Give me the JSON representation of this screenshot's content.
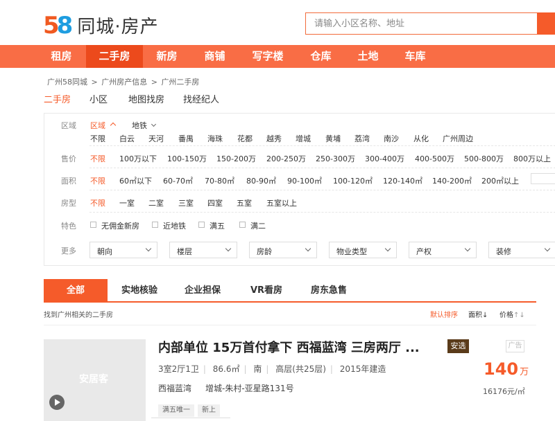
{
  "logo": {
    "digit5": "5",
    "digit8": "8",
    "text": "同城·房产"
  },
  "search": {
    "placeholder": "请输入小区名称、地址"
  },
  "nav": [
    "租房",
    "二手房",
    "新房",
    "商铺",
    "写字楼",
    "仓库",
    "土地",
    "车库"
  ],
  "breadcrumb": [
    "广州58同城",
    ">",
    "广州房产信息",
    ">",
    "广州二手房"
  ],
  "categories": [
    "二手房",
    "小区",
    "地图找房",
    "找经纪人"
  ],
  "filters": {
    "region_label": "区域",
    "region_tab": "区域",
    "metro_tab": "地铁",
    "districts": [
      "不限",
      "白云",
      "天河",
      "番禺",
      "海珠",
      "花都",
      "越秀",
      "增城",
      "黄埔",
      "荔湾",
      "南沙",
      "从化",
      "广州周边"
    ],
    "price_label": "售价",
    "prices": [
      "不限",
      "100万以下",
      "100-150万",
      "150-200万",
      "200-250万",
      "250-300万",
      "300-400万",
      "400-500万",
      "500-800万",
      "800万以上"
    ],
    "area_label": "面积",
    "areas": [
      "不限",
      "60㎡以下",
      "60-70㎡",
      "70-80㎡",
      "80-90㎡",
      "90-100㎡",
      "100-120㎡",
      "120-140㎡",
      "140-200㎡",
      "200㎡以上"
    ],
    "room_label": "房型",
    "rooms": [
      "不限",
      "一室",
      "二室",
      "三室",
      "四室",
      "五室",
      "五室以上"
    ],
    "feature_label": "特色",
    "features": [
      "无佣金新房",
      "近地铁",
      "满五",
      "满二"
    ],
    "more_label": "更多",
    "more": [
      "朝向",
      "楼层",
      "房龄",
      "物业类型",
      "产权",
      "装修"
    ]
  },
  "tabs": [
    "全部",
    "实地核验",
    "企业担保",
    "VR看房",
    "房东急售"
  ],
  "result_text": "找到广州相关的二手房",
  "sort": {
    "default": "默认排序",
    "area": "面积",
    "area_arrow": "↓",
    "price": "价格",
    "price_arrow": "↑↓"
  },
  "listing": {
    "watermark": "安居客",
    "title": "内部单位 15万首付拿下 西福蓝湾 三房两厅 ...",
    "badge": "安选",
    "ad": "广告",
    "layout": "3室2厅1卫",
    "area": "86.6㎡",
    "orientation": "南",
    "floor": "高层(共25层)",
    "built": "2015年建造",
    "community": "西福蓝湾",
    "address": "增城-朱村-亚星路131号",
    "price": "140",
    "price_unit": "万",
    "unit_price": "16176元/㎡",
    "tags": [
      "满五唯一",
      "新上"
    ]
  },
  "colors": {
    "accent": "#f55b2a",
    "nav_bg": "#f96d45",
    "nav_active": "#ec4a1c",
    "logo_5": "#f05a21",
    "logo_8": "#1e9de0",
    "badge_bg": "#5a3b1a"
  }
}
